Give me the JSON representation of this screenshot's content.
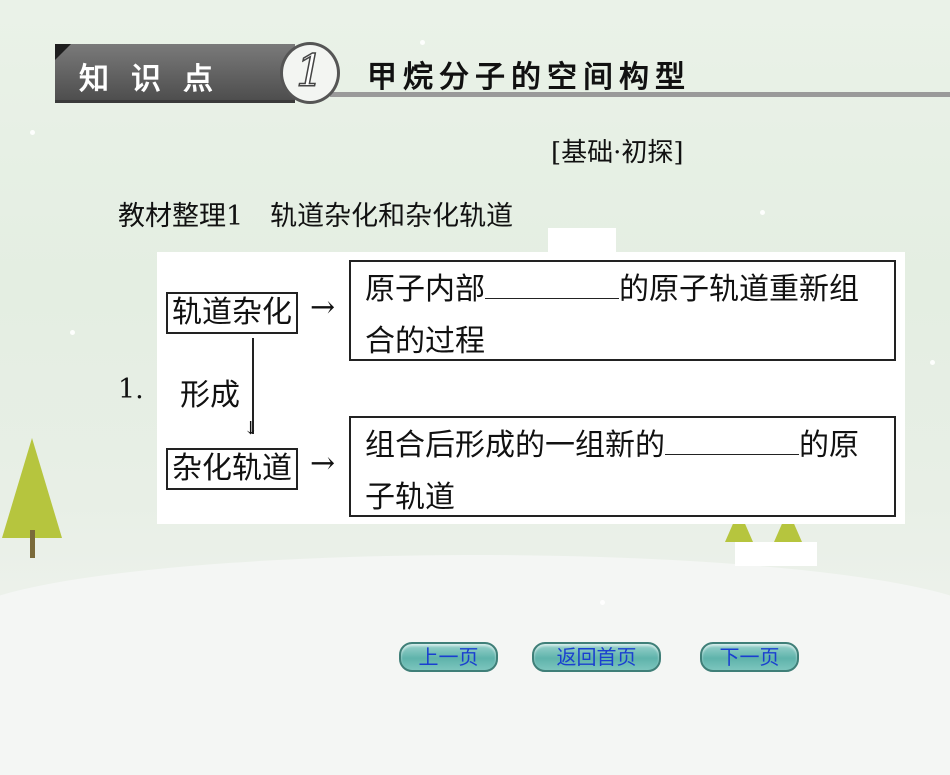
{
  "header": {
    "label": "知识点",
    "badge": "1",
    "title": "甲烷分子的空间构型"
  },
  "tag": "[基础·初探]",
  "section_title": "教材整理1　轨道杂化和杂化轨道",
  "diagram": {
    "number": "1.",
    "box1_label": "轨道杂化",
    "box1_desc_before": "原子内部",
    "box1_desc_after": "的原子轨道重新组合的过程",
    "arrow_label": "形成",
    "box2_label": "杂化轨道",
    "box2_desc_before": "组合后形成的一组新的",
    "box2_desc_after": "的原子轨道",
    "arrow_right": "→"
  },
  "nav": {
    "prev": "上一页",
    "home": "返回首页",
    "next": "下一页"
  }
}
